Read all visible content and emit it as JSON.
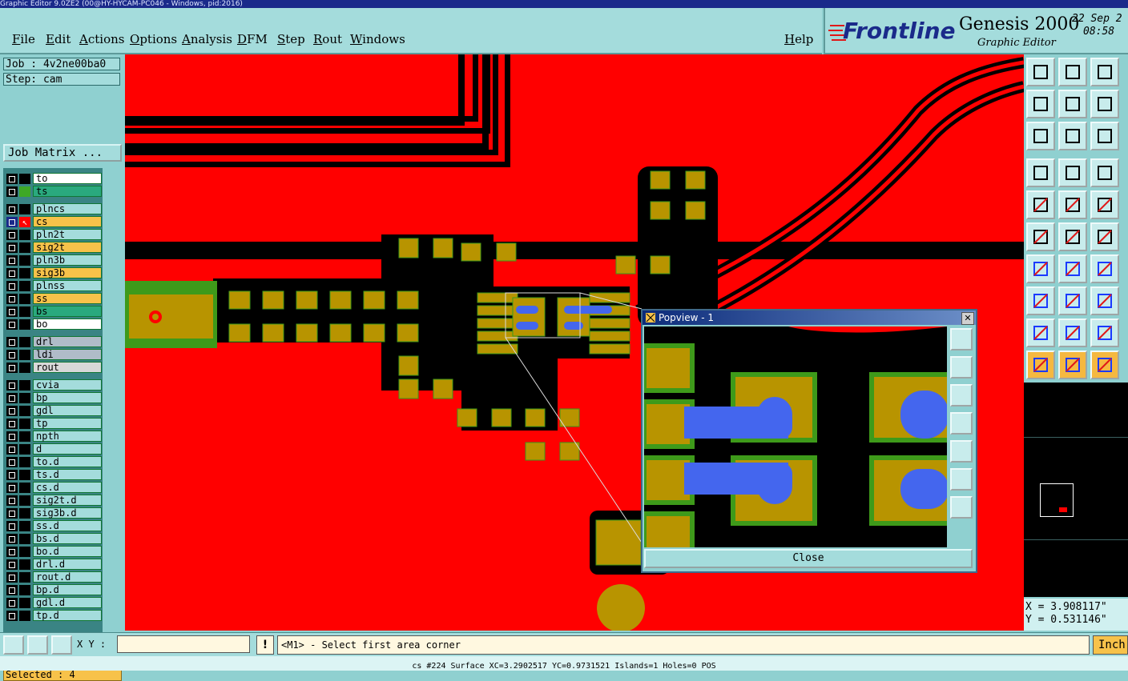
{
  "window": {
    "title": "Graphic Editor 9.0ZE2 (00@HY-HYCAM-PC046 - Windows, pid:2016)"
  },
  "menu": {
    "items": [
      "File",
      "Edit",
      "Actions",
      "Options",
      "Analysis",
      "DFM",
      "Step",
      "Rout",
      "Windows"
    ],
    "help": "Help"
  },
  "brand": {
    "logo": "Frontline",
    "product": "Genesis 2000",
    "subtitle": "Graphic Editor",
    "date": "22 Sep 2",
    "time": "08:58"
  },
  "job": {
    "job_label": "Job : 4v2ne00ba0",
    "step_label": "Step: cam",
    "matrix_button": "Job Matrix ..."
  },
  "layers": [
    {
      "name": "to",
      "color": "#ffffff",
      "swatch": "#000000"
    },
    {
      "name": "ts",
      "color": "#2aa97e",
      "swatch": "#3ea826"
    },
    {
      "name": "plncs",
      "color": "#a4dcdc",
      "swatch": "#000000"
    },
    {
      "name": "cs",
      "color": "#f7c24a",
      "swatch": "#ff0000",
      "active": true
    },
    {
      "name": "pln2t",
      "color": "#a4dcdc",
      "swatch": "#000000"
    },
    {
      "name": "sig2t",
      "color": "#f7c24a",
      "swatch": "#000000"
    },
    {
      "name": "pln3b",
      "color": "#a4dcdc",
      "swatch": "#000000"
    },
    {
      "name": "sig3b",
      "color": "#f7c24a",
      "swatch": "#000000"
    },
    {
      "name": "plnss",
      "color": "#a4dcdc",
      "swatch": "#000000"
    },
    {
      "name": "ss",
      "color": "#f7c24a",
      "swatch": "#000000"
    },
    {
      "name": "bs",
      "color": "#2aa97e",
      "swatch": "#000000"
    },
    {
      "name": "bo",
      "color": "#ffffff",
      "swatch": "#000000"
    },
    {
      "name": "drl",
      "color": "#b0bcc8",
      "swatch": "#000000"
    },
    {
      "name": "ldi",
      "color": "#b0bcc8",
      "swatch": "#000000"
    },
    {
      "name": "rout",
      "color": "#d8d8d8",
      "swatch": "#000000"
    },
    {
      "name": "cvia",
      "color": "#a4dcdc",
      "swatch": "#000000"
    },
    {
      "name": "bp",
      "color": "#a4dcdc",
      "swatch": "#000000"
    },
    {
      "name": "gdl",
      "color": "#a4dcdc",
      "swatch": "#000000"
    },
    {
      "name": "tp",
      "color": "#a4dcdc",
      "swatch": "#000000"
    },
    {
      "name": "npth",
      "color": "#a4dcdc",
      "swatch": "#000000"
    },
    {
      "name": "d",
      "color": "#a4dcdc",
      "swatch": "#000000"
    },
    {
      "name": "to.d",
      "color": "#a4dcdc",
      "swatch": "#000000"
    },
    {
      "name": "ts.d",
      "color": "#a4dcdc",
      "swatch": "#000000"
    },
    {
      "name": "cs.d",
      "color": "#a4dcdc",
      "swatch": "#000000"
    },
    {
      "name": "sig2t.d",
      "color": "#a4dcdc",
      "swatch": "#000000"
    },
    {
      "name": "sig3b.d",
      "color": "#a4dcdc",
      "swatch": "#000000"
    },
    {
      "name": "ss.d",
      "color": "#a4dcdc",
      "swatch": "#000000"
    },
    {
      "name": "bs.d",
      "color": "#a4dcdc",
      "swatch": "#000000"
    },
    {
      "name": "bo.d",
      "color": "#a4dcdc",
      "swatch": "#000000"
    },
    {
      "name": "drl.d",
      "color": "#a4dcdc",
      "swatch": "#000000"
    },
    {
      "name": "rout.d",
      "color": "#a4dcdc",
      "swatch": "#000000"
    },
    {
      "name": "bp.d",
      "color": "#a4dcdc",
      "swatch": "#000000"
    },
    {
      "name": "gdl.d",
      "color": "#a4dcdc",
      "swatch": "#000000"
    },
    {
      "name": "tp.d",
      "color": "#a4dcdc",
      "swatch": "#000000"
    }
  ],
  "selected": "Selected : 4",
  "coords": {
    "x": "X = 3.908117\"",
    "y": "Y = 0.531146\""
  },
  "bottom": {
    "xy_label": "X Y :",
    "xy_value": "",
    "prompt": "<M1> - Select first area corner",
    "units": "Inch"
  },
  "status_line": "cs #224 Surface XC=3.2902517 YC=0.9731521 Islands=1 Holes=0 POS",
  "popview": {
    "title": "Popview - 1",
    "close": "Close"
  },
  "colors": {
    "board": "#ff0000",
    "pad": "#b89400",
    "mask": "#3e9a1a",
    "highlight": "#4466ee",
    "panel": "#8fd0d0"
  }
}
